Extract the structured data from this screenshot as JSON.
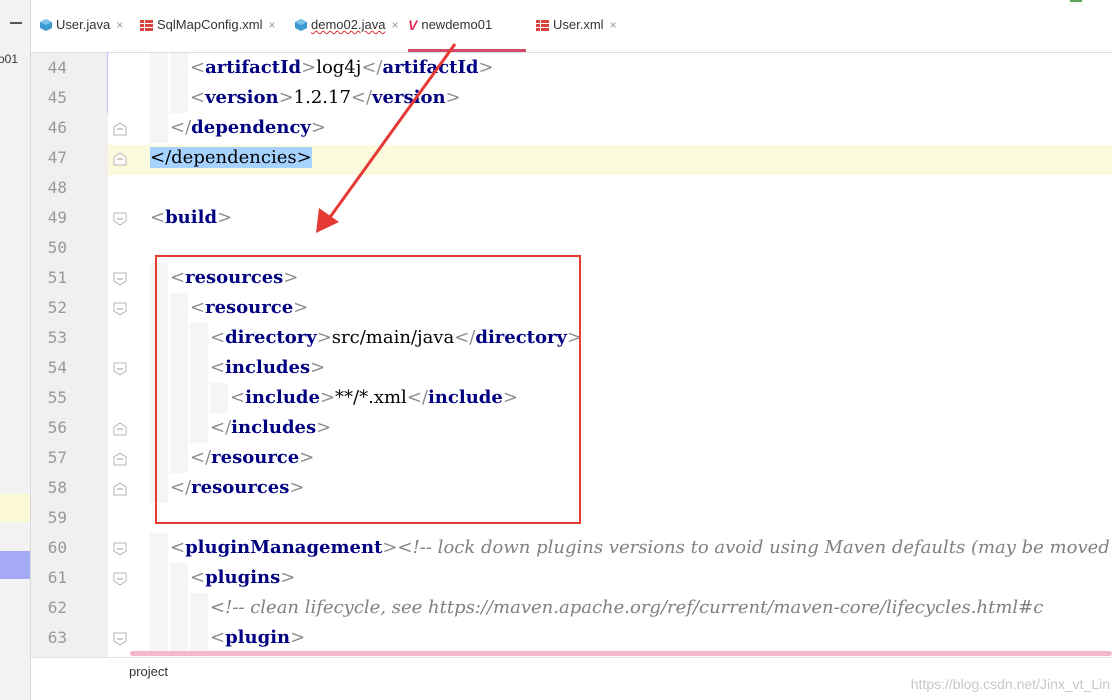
{
  "sidebar": {
    "label": "o01"
  },
  "tabs": [
    {
      "label": "User.java",
      "icon": "java-class-icon",
      "active": false
    },
    {
      "label": "SqlMapConfig.xml",
      "icon": "xml-file-icon",
      "active": false
    },
    {
      "label": "demo02.java",
      "icon": "java-class-icon",
      "active": false
    },
    {
      "label": "newdemo01",
      "icon": "maven-icon",
      "active": true
    },
    {
      "label": "User.xml",
      "icon": "xml-file-icon",
      "active": false
    }
  ],
  "editor": {
    "lines": [
      {
        "num": "44",
        "indent": 2,
        "fold": "none",
        "tokens": [
          [
            "br",
            "<"
          ],
          [
            "tn",
            "artifactId"
          ],
          [
            "br",
            ">"
          ],
          [
            "tx",
            "log4j"
          ],
          [
            "br",
            "</"
          ],
          [
            "tn",
            "artifactId"
          ],
          [
            "br",
            ">"
          ]
        ]
      },
      {
        "num": "45",
        "indent": 2,
        "fold": "none",
        "tokens": [
          [
            "br",
            "<"
          ],
          [
            "tn",
            "version"
          ],
          [
            "br",
            ">"
          ],
          [
            "tx",
            "1.2.17"
          ],
          [
            "br",
            "</"
          ],
          [
            "tn",
            "version"
          ],
          [
            "br",
            ">"
          ]
        ]
      },
      {
        "num": "46",
        "indent": 1,
        "fold": "end",
        "tokens": [
          [
            "br",
            "</"
          ],
          [
            "tn",
            "dependency"
          ],
          [
            "br",
            ">"
          ]
        ]
      },
      {
        "num": "47",
        "indent": 0,
        "fold": "end",
        "highlight": true,
        "tokens": [
          [
            "sel",
            "</dependencies>"
          ]
        ]
      },
      {
        "num": "48",
        "indent": 0,
        "fold": "none",
        "tokens": []
      },
      {
        "num": "49",
        "indent": 0,
        "fold": "start",
        "tokens": [
          [
            "br",
            "<"
          ],
          [
            "tn",
            "build"
          ],
          [
            "br",
            ">"
          ]
        ]
      },
      {
        "num": "50",
        "indent": 0,
        "fold": "none",
        "tokens": []
      },
      {
        "num": "51",
        "indent": 1,
        "fold": "start",
        "tokens": [
          [
            "br",
            "<"
          ],
          [
            "tn",
            "resources"
          ],
          [
            "br",
            ">"
          ]
        ]
      },
      {
        "num": "52",
        "indent": 2,
        "fold": "start",
        "tokens": [
          [
            "br",
            "<"
          ],
          [
            "tn",
            "resource"
          ],
          [
            "br",
            ">"
          ]
        ]
      },
      {
        "num": "53",
        "indent": 3,
        "fold": "none",
        "tokens": [
          [
            "br",
            "<"
          ],
          [
            "tn",
            "directory"
          ],
          [
            "br",
            ">"
          ],
          [
            "tx",
            "src/main/java"
          ],
          [
            "br",
            "</"
          ],
          [
            "tn",
            "directory"
          ],
          [
            "br",
            ">"
          ]
        ]
      },
      {
        "num": "54",
        "indent": 3,
        "fold": "start",
        "tokens": [
          [
            "br",
            "<"
          ],
          [
            "tn",
            "includes"
          ],
          [
            "br",
            ">"
          ]
        ]
      },
      {
        "num": "55",
        "indent": 4,
        "fold": "none",
        "tokens": [
          [
            "br",
            "<"
          ],
          [
            "tn",
            "include"
          ],
          [
            "br",
            ">"
          ],
          [
            "tx",
            "**/*.xml"
          ],
          [
            "br",
            "</"
          ],
          [
            "tn",
            "include"
          ],
          [
            "br",
            ">"
          ]
        ]
      },
      {
        "num": "56",
        "indent": 3,
        "fold": "end",
        "tokens": [
          [
            "br",
            "</"
          ],
          [
            "tn",
            "includes"
          ],
          [
            "br",
            ">"
          ]
        ]
      },
      {
        "num": "57",
        "indent": 2,
        "fold": "end",
        "tokens": [
          [
            "br",
            "</"
          ],
          [
            "tn",
            "resource"
          ],
          [
            "br",
            ">"
          ]
        ]
      },
      {
        "num": "58",
        "indent": 1,
        "fold": "end",
        "tokens": [
          [
            "br",
            "</"
          ],
          [
            "tn",
            "resources"
          ],
          [
            "br",
            ">"
          ]
        ]
      },
      {
        "num": "59",
        "indent": 0,
        "fold": "none",
        "tokens": []
      },
      {
        "num": "60",
        "indent": 1,
        "fold": "start",
        "tokens": [
          [
            "br",
            "<"
          ],
          [
            "tn",
            "pluginManagement"
          ],
          [
            "br",
            ">"
          ],
          [
            "cm",
            "<!-- lock down plugins versions to avoid using Maven defaults (may be moved"
          ]
        ]
      },
      {
        "num": "61",
        "indent": 2,
        "fold": "start",
        "tokens": [
          [
            "br",
            "<"
          ],
          [
            "tn",
            "plugins"
          ],
          [
            "br",
            ">"
          ]
        ]
      },
      {
        "num": "62",
        "indent": 3,
        "fold": "none",
        "tokens": [
          [
            "cm",
            "<!-- clean lifecycle, see https://maven.apache.org/ref/current/maven-core/lifecycles.html#c"
          ]
        ]
      },
      {
        "num": "63",
        "indent": 3,
        "fold": "start",
        "tokens": [
          [
            "br",
            "<"
          ],
          [
            "tn",
            "plugin"
          ],
          [
            "br",
            ">"
          ]
        ]
      }
    ]
  },
  "statusbar": {
    "project_label": "project"
  },
  "watermark": "https://blog.csdn.net/Jinx_vt_Lin",
  "colors": {
    "annotation_red": "#e53935",
    "active_tab_underline": "#d24a6a",
    "tag_name": "#000080"
  }
}
